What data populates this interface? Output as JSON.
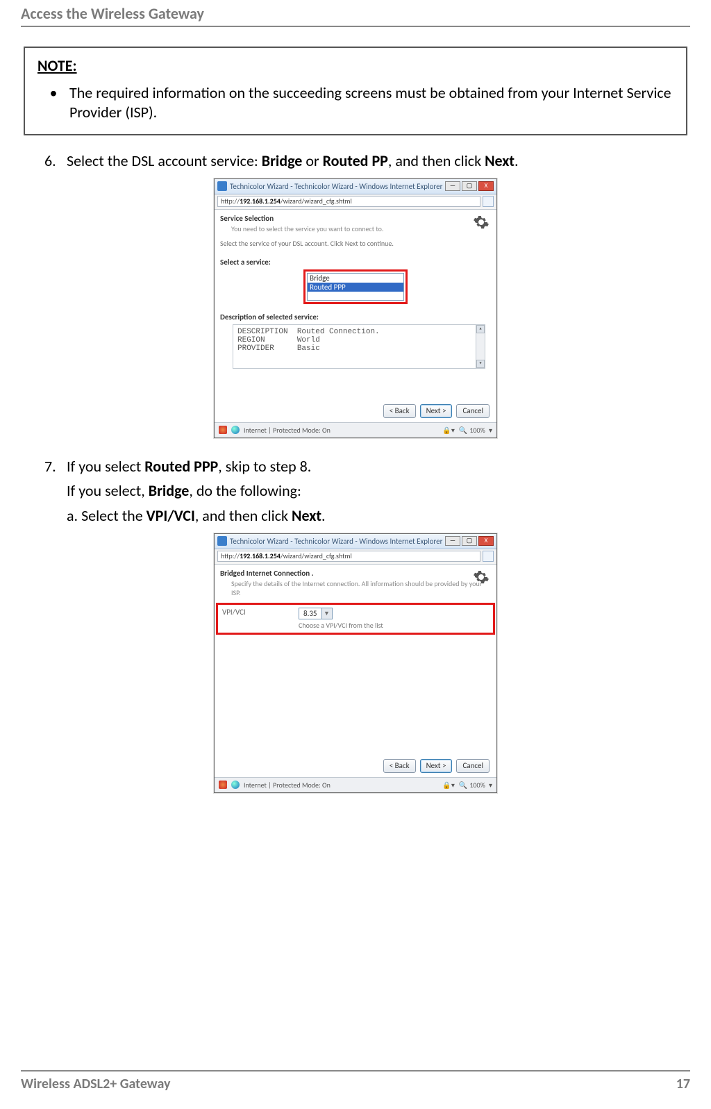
{
  "header": {
    "title": "Access the Wireless Gateway"
  },
  "note": {
    "label": "NOTE:",
    "text": "The required information on the succeeding screens must be obtained from your Internet Service Provider (ISP)."
  },
  "step6": {
    "num": "6.",
    "pre": "Select the DSL account service: ",
    "b1": "Bridge",
    "mid1": " or ",
    "b2": "Routed PP",
    "mid2": ", and then click ",
    "b3": "Next",
    "post": "."
  },
  "step7": {
    "num": "7.",
    "line1_pre": "If you select ",
    "line1_b": "Routed PPP",
    "line1_post": ", skip to step 8.",
    "line2_pre": "If you select, ",
    "line2_b": "Bridge",
    "line2_post": ", do the following:",
    "sub_a_pre": "a. Select the ",
    "sub_a_b": "VPI/VCI",
    "sub_a_mid": ", and then click ",
    "sub_a_b2": "Next",
    "sub_a_post": "."
  },
  "ie": {
    "title": "Technicolor Wizard - Technicolor Wizard - Windows Internet Explorer",
    "url_pre": "http://",
    "url_host": "192.168.1.254",
    "url_path": "/wizard/wizard_cfg.shtml",
    "win_min": "—",
    "win_max": "▢",
    "win_close": "X",
    "status_text": "Internet | Protected Mode: On",
    "zoom": "100%",
    "btn_back": "< Back",
    "btn_next": "Next >",
    "btn_cancel": "Cancel"
  },
  "screen1": {
    "sec_title": "Service Selection",
    "sec_desc": "You need to select the service you want to connect to.",
    "prompt": "Select the service of your DSL account. Click Next to continue.",
    "label": "Select a service:",
    "opt1": "Bridge",
    "opt2": "Routed PPP",
    "desc_label": "Description of selected service:",
    "d1a": "DESCRIPTION",
    "d1b": "Routed Connection.",
    "d2a": "REGION",
    "d2b": "World",
    "d3a": "PROVIDER",
    "d3b": "Basic"
  },
  "screen2": {
    "sec_title": "Bridged Internet Connection .",
    "sec_desc": "Specify the details of the Internet connection. All information should be provided by your ISP.",
    "label": "VPI/VCI",
    "value": "8.35",
    "hint": "Choose a VPI/VCI from the list"
  },
  "footer": {
    "left": "Wireless ADSL2+ Gateway",
    "right": "17"
  }
}
